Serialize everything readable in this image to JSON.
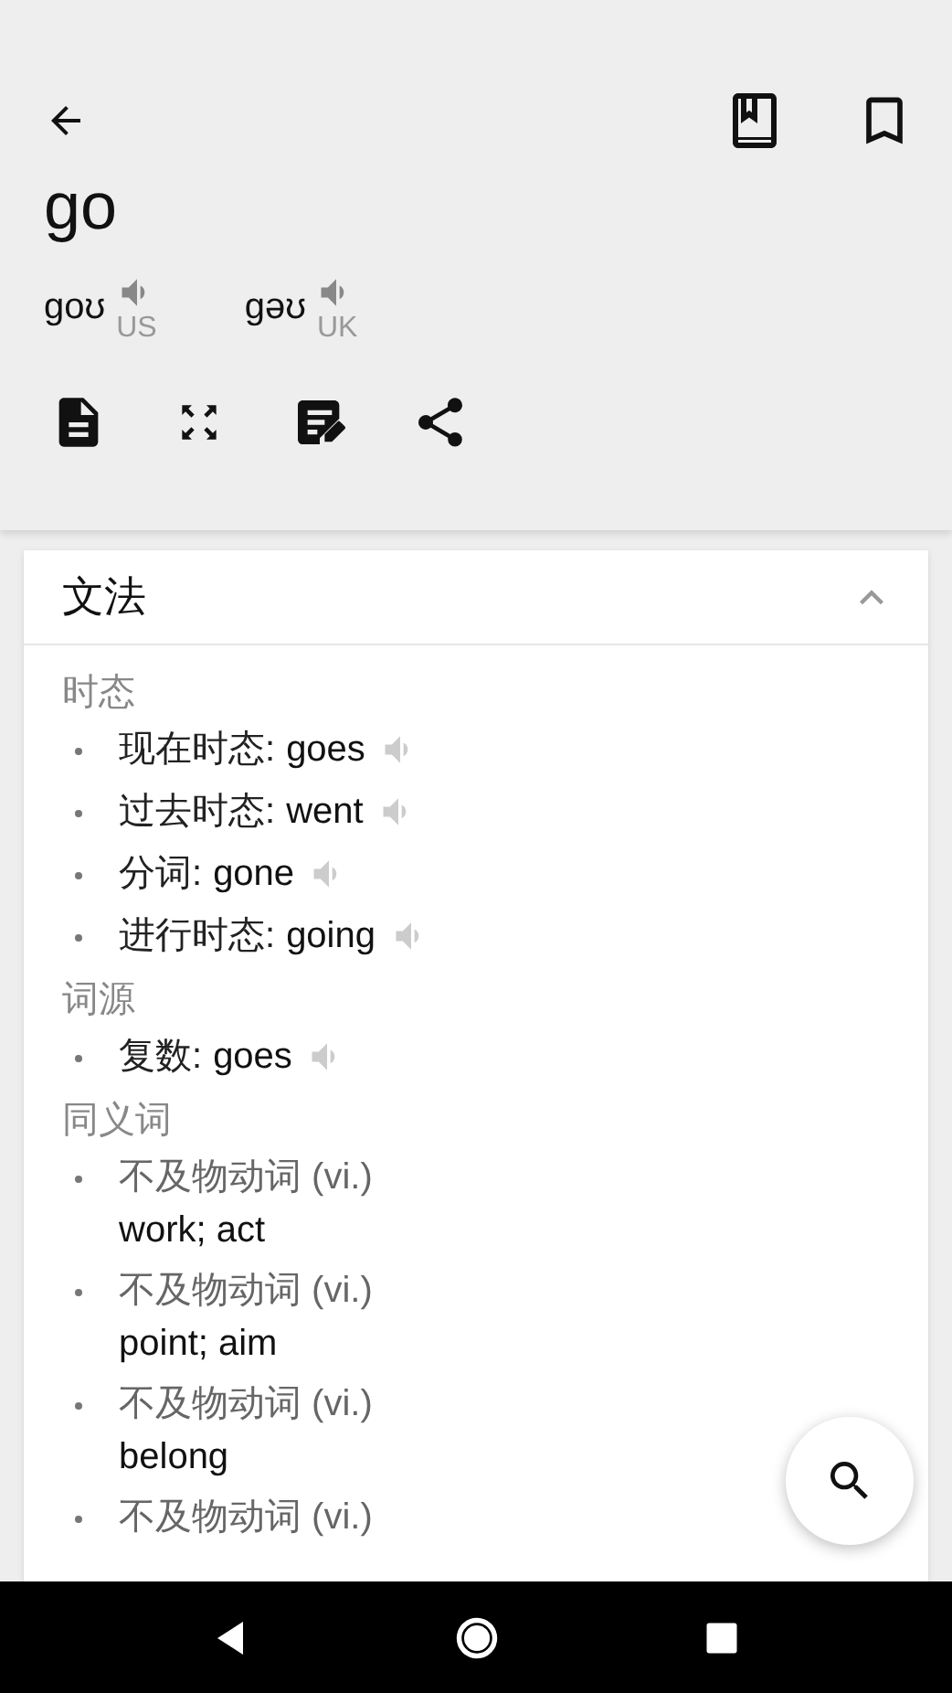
{
  "header": {
    "word": "go",
    "pronunciations": [
      {
        "phonetic": "goʊ",
        "region": "US"
      },
      {
        "phonetic": "gəʊ",
        "region": "UK"
      }
    ]
  },
  "card": {
    "title": "文法",
    "expanded": true,
    "sections": [
      {
        "heading": "时态",
        "items": [
          {
            "label": "现在时态:",
            "value": "goes",
            "audio": true
          },
          {
            "label": "过去时态:",
            "value": "went",
            "audio": true
          },
          {
            "label": "分词:",
            "value": "gone",
            "audio": true
          },
          {
            "label": "进行时态:",
            "value": "going",
            "audio": true
          }
        ]
      },
      {
        "heading": "词源",
        "items": [
          {
            "label": "复数:",
            "value": "goes",
            "audio": true
          }
        ]
      },
      {
        "heading": "同义词",
        "items": [
          {
            "label": "不及物动词 (vi.)",
            "meaning": "work; act",
            "audio": false
          },
          {
            "label": "不及物动词 (vi.)",
            "meaning": "point; aim",
            "audio": false
          },
          {
            "label": "不及物动词 (vi.)",
            "meaning": "belong",
            "audio": false
          },
          {
            "label": "不及物动词 (vi.)",
            "audio": false
          }
        ]
      }
    ]
  }
}
